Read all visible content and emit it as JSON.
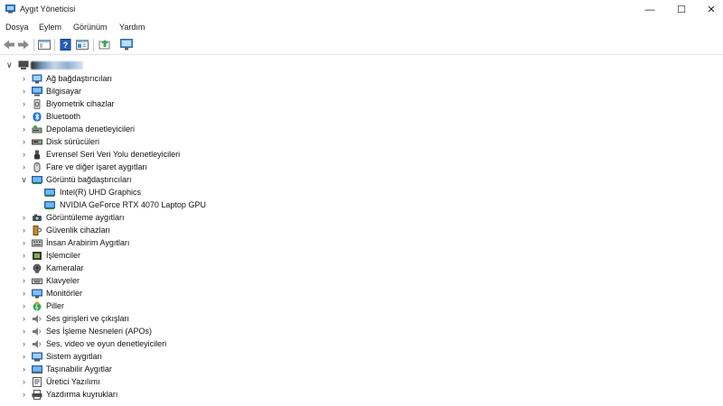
{
  "window": {
    "title": "Aygıt Yöneticisi",
    "minimize_glyph": "—",
    "maximize_glyph": "☐",
    "close_glyph": "✕"
  },
  "menu": {
    "items": [
      "Dosya",
      "Eylem",
      "Görünüm",
      "Yardım"
    ]
  },
  "toolbar": {
    "icons": [
      "back-arrow-icon",
      "forward-arrow-icon",
      "show-hide-console-tree-icon",
      "help-icon",
      "properties-icon",
      "update-driver-icon",
      "scan-hardware-icon"
    ]
  },
  "tree": {
    "root_expanded": true,
    "categories": [
      {
        "label": "Ağ bağdaştırıcıları",
        "icon": "network-adapter-icon",
        "expanded": false
      },
      {
        "label": "Bilgisayar",
        "icon": "computer-icon",
        "expanded": false
      },
      {
        "label": "Biyometrik cihazlar",
        "icon": "biometric-icon",
        "expanded": false
      },
      {
        "label": "Bluetooth",
        "icon": "bluetooth-icon",
        "expanded": false
      },
      {
        "label": "Depolama denetleyicileri",
        "icon": "storage-controller-icon",
        "expanded": false
      },
      {
        "label": "Disk sürücüleri",
        "icon": "disk-drive-icon",
        "expanded": false
      },
      {
        "label": "Evrensel Seri Veri Yolu denetleyicileri",
        "icon": "usb-icon",
        "expanded": false
      },
      {
        "label": "Fare ve diğer işaret aygıtları",
        "icon": "mouse-icon",
        "expanded": false
      },
      {
        "label": "Görüntü bağdaştırıcıları",
        "icon": "display-adapter-icon",
        "expanded": true,
        "children": [
          {
            "label": "Intel(R) UHD Graphics",
            "icon": "display-adapter-icon"
          },
          {
            "label": "NVIDIA GeForce RTX 4070 Laptop GPU",
            "icon": "display-adapter-icon"
          }
        ]
      },
      {
        "label": "Görüntüleme aygıtları",
        "icon": "imaging-device-icon",
        "expanded": false
      },
      {
        "label": "Güvenlik cihazları",
        "icon": "security-device-icon",
        "expanded": false
      },
      {
        "label": "İnsan Arabirim Aygıtları",
        "icon": "hid-icon",
        "expanded": false
      },
      {
        "label": "İşlemciler",
        "icon": "processor-icon",
        "expanded": false
      },
      {
        "label": "Kameralar",
        "icon": "camera-icon",
        "expanded": false
      },
      {
        "label": "Klavyeler",
        "icon": "keyboard-icon",
        "expanded": false
      },
      {
        "label": "Monitörler",
        "icon": "monitor-icon",
        "expanded": false
      },
      {
        "label": "Piller",
        "icon": "battery-icon",
        "expanded": false
      },
      {
        "label": "Ses girişleri ve çıkışları",
        "icon": "audio-io-icon",
        "expanded": false
      },
      {
        "label": "Ses İşleme Nesneleri (APOs)",
        "icon": "audio-processing-icon",
        "expanded": false
      },
      {
        "label": "Ses, video ve oyun denetleyicileri",
        "icon": "sound-video-icon",
        "expanded": false
      },
      {
        "label": "Sistem aygıtları",
        "icon": "system-device-icon",
        "expanded": false
      },
      {
        "label": "Taşınabilir Aygıtlar",
        "icon": "portable-device-icon",
        "expanded": false
      },
      {
        "label": "Üretici Yazılımı",
        "icon": "firmware-icon",
        "expanded": false
      },
      {
        "label": "Yazdırma kuyrukları",
        "icon": "print-queue-icon",
        "expanded": false
      }
    ]
  },
  "colors": {
    "icon_blue": "#2f7fd0",
    "icon_dark": "#3a3a3a",
    "toolbar_green": "#3aa655",
    "help_blue": "#1f5fbf"
  }
}
